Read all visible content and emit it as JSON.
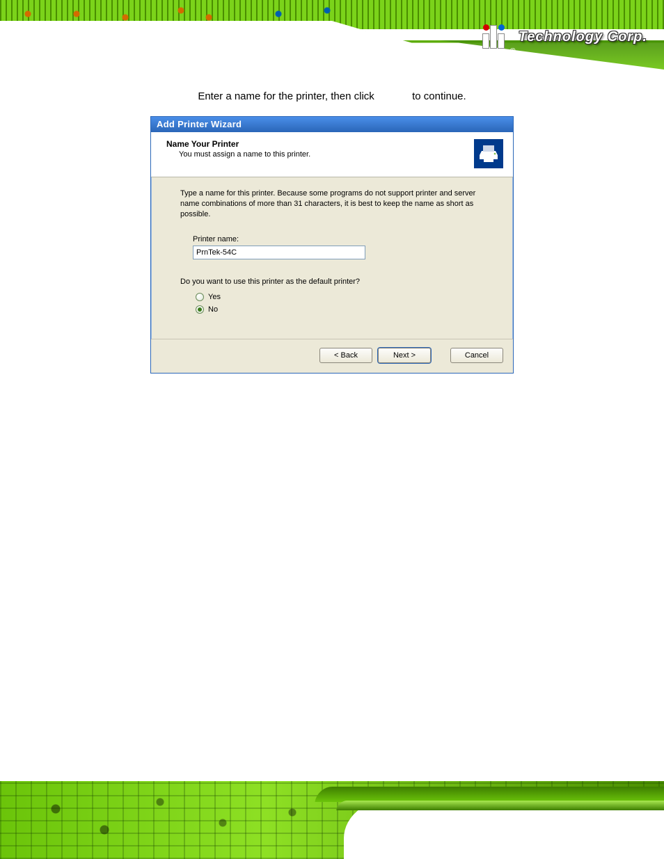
{
  "brand": {
    "registered": "®",
    "name": "Technology Corp."
  },
  "instruction": {
    "before": "Enter a name for the printer, then click",
    "after": "to continue."
  },
  "dialog": {
    "title": "Add Printer Wizard",
    "header_title": "Name Your Printer",
    "header_sub": "You must assign a name to this printer.",
    "description": "Type a name for this printer. Because some programs do not support printer and server name combinations of more than 31 characters, it is best to keep the name as short as possible.",
    "field_label": "Printer name:",
    "field_value": "PrnTek-54C",
    "question": "Do you want to use this printer as the default printer?",
    "radio_yes": "Yes",
    "radio_no": "No",
    "selected": "no",
    "buttons": {
      "back": "< Back",
      "next": "Next >",
      "cancel": "Cancel"
    }
  }
}
